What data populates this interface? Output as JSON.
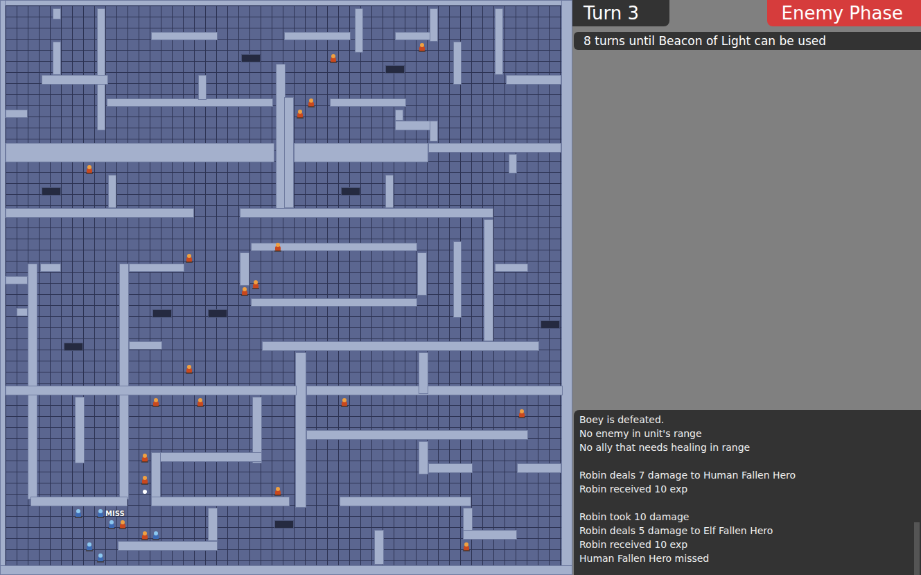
{
  "hud": {
    "turn": "Turn 3",
    "phase": "Enemy Phase",
    "notice": "8 turns until Beacon of Light can be used"
  },
  "map": {
    "popup": "MISS",
    "units": [
      {
        "kind": "enemy"
      },
      {
        "kind": "enemy"
      },
      {
        "kind": "enemy"
      },
      {
        "kind": "enemy"
      },
      {
        "kind": "enemy"
      },
      {
        "kind": "enemy"
      },
      {
        "kind": "enemy"
      },
      {
        "kind": "enemy"
      },
      {
        "kind": "enemy"
      },
      {
        "kind": "enemy"
      },
      {
        "kind": "enemy"
      },
      {
        "kind": "enemy"
      },
      {
        "kind": "enemy"
      },
      {
        "kind": "enemy"
      },
      {
        "kind": "enemy"
      },
      {
        "kind": "enemy"
      },
      {
        "kind": "enemy"
      },
      {
        "kind": "enemy"
      },
      {
        "kind": "enemy"
      },
      {
        "kind": "enemy"
      },
      {
        "kind": "item"
      },
      {
        "kind": "ally"
      },
      {
        "kind": "ally"
      },
      {
        "kind": "ally"
      },
      {
        "kind": "ally"
      },
      {
        "kind": "ally"
      },
      {
        "kind": "ally"
      }
    ]
  },
  "log": [
    "Boey is defeated.",
    "No enemy in unit's range",
    "No ally that needs healing in range",
    "",
    "Robin deals 7 damage to Human Fallen Hero",
    "Robin received 10 exp",
    "",
    "Robin took 10 damage",
    "Robin deals 5 damage to Elf Fallen Hero",
    "Robin received 10 exp",
    "Human Fallen Hero missed"
  ]
}
